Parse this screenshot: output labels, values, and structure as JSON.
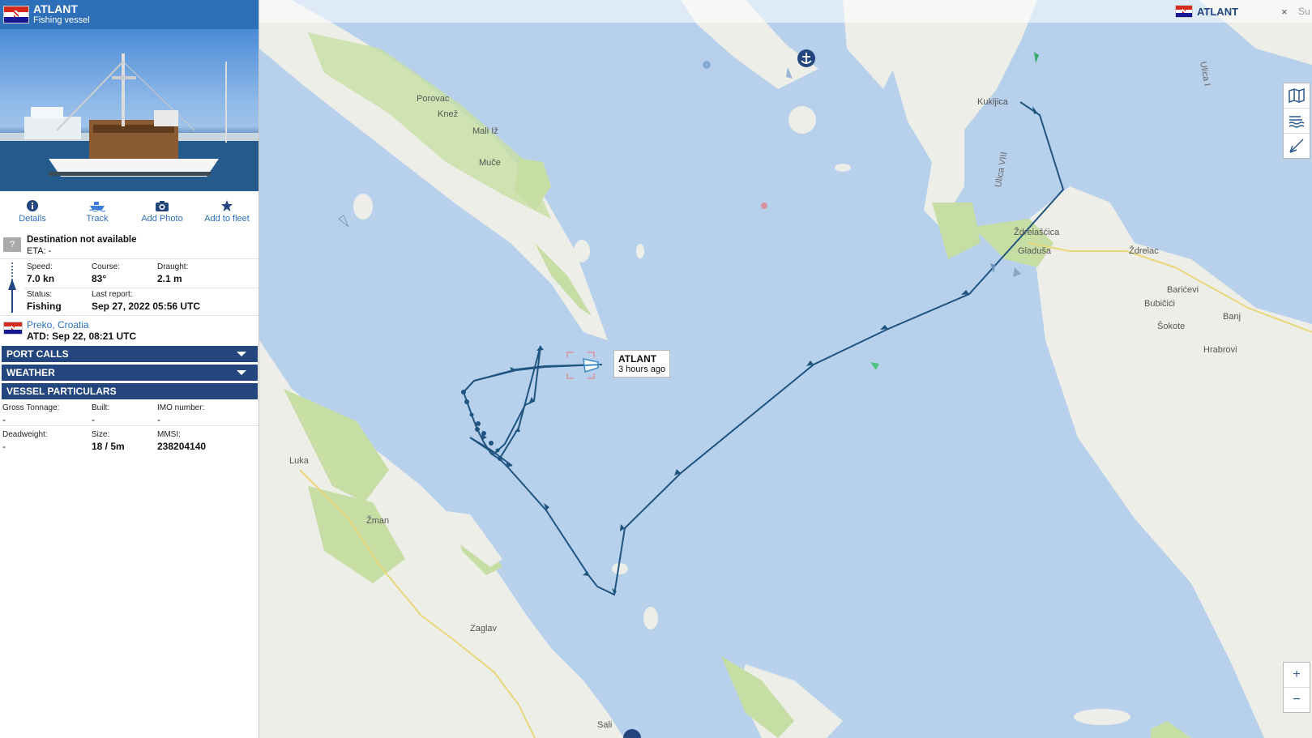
{
  "vessel": {
    "name": "ATLANT",
    "type": "Fishing vessel"
  },
  "tabs": [
    {
      "label": "Details",
      "icon": "info-icon"
    },
    {
      "label": "Track",
      "icon": "ship-icon"
    },
    {
      "label": "Add Photo",
      "icon": "camera-icon"
    },
    {
      "label": "Add to fleet",
      "icon": "star-icon"
    }
  ],
  "destination": {
    "badge": "?",
    "title": "Destination not available",
    "eta": "ETA: -"
  },
  "voyage": {
    "speed_label": "Speed:",
    "speed": "7.0 kn",
    "course_label": "Course:",
    "course": "83°",
    "draught_label": "Draught:",
    "draught": "2.1 m",
    "status_label": "Status:",
    "status": "Fishing",
    "report_label": "Last report:",
    "report": "Sep 27, 2022 05:56 UTC"
  },
  "departure": {
    "port": "Preko, Croatia",
    "atd": "ATD: Sep 22, 08:21 UTC"
  },
  "sections": {
    "port_calls": "PORT CALLS",
    "weather": "WEATHER",
    "particulars": "VESSEL PARTICULARS"
  },
  "particulars": {
    "gt_label": "Gross Tonnage:",
    "gt": "-",
    "built_label": "Built:",
    "built": "-",
    "imo_label": "IMO number:",
    "imo": "-",
    "dwt_label": "Deadweight:",
    "dwt": "-",
    "size_label": "Size:",
    "size": "18 / 5m",
    "mmsi_label": "MMSI:",
    "mmsi": "238204140"
  },
  "map": {
    "header_vessel": "ATLANT",
    "header_close": "×",
    "corner_text": "Su",
    "tooltip_name": "ATLANT",
    "tooltip_time": "3 hours ago",
    "places": [
      "Porovac",
      "Knež",
      "Mali Iž",
      "Muče",
      "Kukljica",
      "Ždrelac",
      "Ždrelašćica",
      "Gladuša",
      "Barićevi",
      "Bubičići",
      "Banj",
      "Šokote",
      "Hrabrovi",
      "Luka",
      "Žman",
      "Zaglav",
      "Sali"
    ],
    "roads": [
      "Ulica I",
      "Ulica VIII"
    ],
    "zoom_in": "+",
    "zoom_out": "−",
    "colors": {
      "water": "#b7d0ec",
      "land": "#eeeee8",
      "forest": "#c6dea4",
      "track": "#1f5480"
    }
  }
}
